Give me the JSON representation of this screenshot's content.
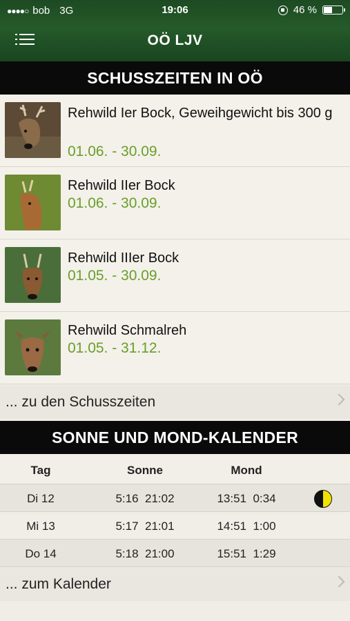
{
  "status": {
    "carrier": "bob",
    "network": "3G",
    "time": "19:06",
    "battery": "46 %",
    "battery_level": 0.46
  },
  "nav": {
    "title": "OÖ LJV"
  },
  "schusszeiten": {
    "header": "SCHUSSZEITEN IN OÖ",
    "items": [
      {
        "title": "Rehwild Ier Bock, Geweihgewicht bis 300 g",
        "dates": "01.06. - 30.09."
      },
      {
        "title": "Rehwild IIer Bock",
        "dates": "01.06. - 30.09."
      },
      {
        "title": "Rehwild IIIer Bock",
        "dates": "01.05. - 30.09."
      },
      {
        "title": "Rehwild Schmalreh",
        "dates": "01.05. - 31.12."
      }
    ],
    "link_label": "... zu den Schusszeiten"
  },
  "kalender": {
    "header": "SONNE UND MOND-KALENDER",
    "columns": {
      "tag": "Tag",
      "sonne": "Sonne",
      "mond": "Mond"
    },
    "rows": [
      {
        "tag": "Di 12",
        "sonne": "5:16  21:02",
        "mond": "13:51  0:34",
        "moon_icon": "half-moon-icon"
      },
      {
        "tag": "Mi 13",
        "sonne": "5:17  21:01",
        "mond": "14:51  1:00"
      },
      {
        "tag": "Do 14",
        "sonne": "5:18  21:00",
        "mond": "15:51  1:29"
      }
    ],
    "link_label": "... zum Kalender"
  },
  "colors": {
    "header_green": "#1d4a22",
    "date_green": "#6a9e2a",
    "section_black": "#0a0a0a",
    "moon_yellow": "#f2e400"
  }
}
